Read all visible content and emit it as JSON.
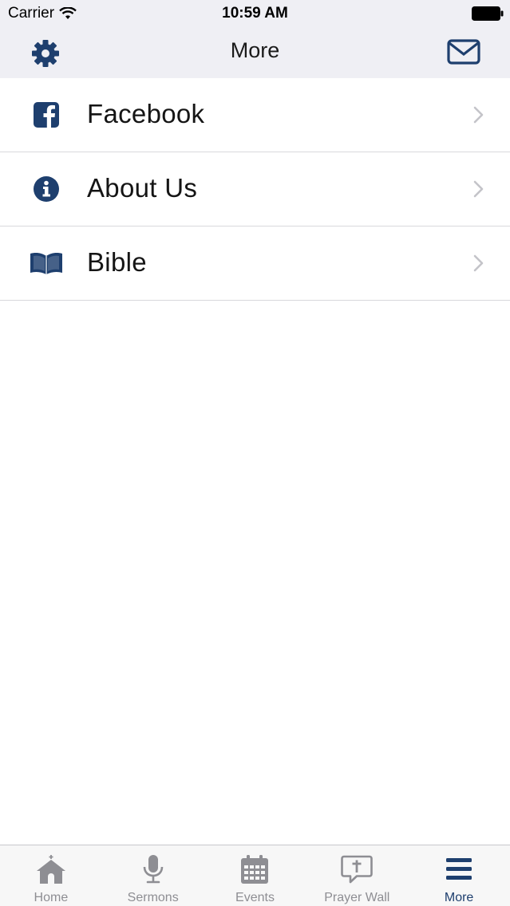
{
  "status_bar": {
    "carrier": "Carrier",
    "time": "10:59 AM"
  },
  "nav": {
    "title": "More",
    "left_icon": "gear-icon",
    "right_icon": "mail-icon"
  },
  "list": {
    "items": [
      {
        "label": "Facebook",
        "icon": "facebook-icon"
      },
      {
        "label": "About Us",
        "icon": "info-icon"
      },
      {
        "label": "Bible",
        "icon": "bible-icon"
      }
    ]
  },
  "tabs": [
    {
      "label": "Home",
      "icon": "church-icon",
      "active": false
    },
    {
      "label": "Sermons",
      "icon": "microphone-icon",
      "active": false
    },
    {
      "label": "Events",
      "icon": "calendar-icon",
      "active": false
    },
    {
      "label": "Prayer Wall",
      "icon": "prayer-bubble-icon",
      "active": false
    },
    {
      "label": "More",
      "icon": "menu-icon",
      "active": true
    }
  ],
  "colors": {
    "accent": "#1e3f6e",
    "inactive": "#8e8e93",
    "header_bg": "#efeff4"
  }
}
